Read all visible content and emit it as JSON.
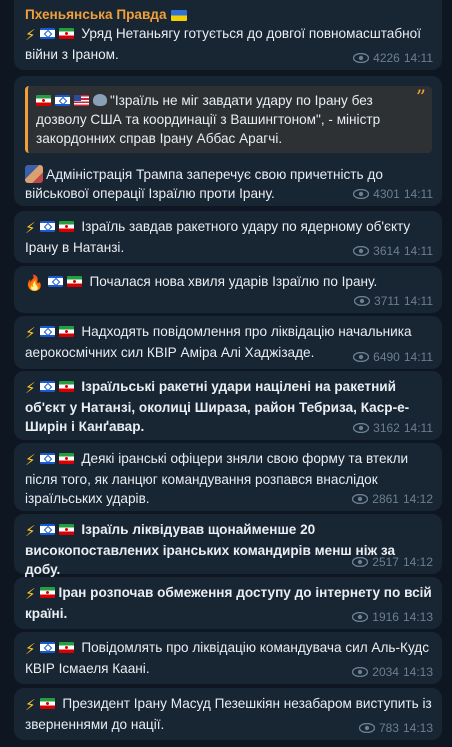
{
  "channel": {
    "name": "Пхеньянська Правда"
  },
  "posts": [
    {
      "text": "Уряд Нетаньягу готується до довгої повномасштабної війни з Іраном.",
      "views": "4226",
      "time": "14:11"
    },
    {
      "quote": "\"Ізраїль не міг завдати удару по Ірану без дозволу США та координації з Вашингтоном\", - міністр закордонних справ Ірану Аббас Арагчі.",
      "text": "Адміністрація Трампа заперечує свою причетність до військової операції Ізраїлю проти Ірану.",
      "views": "4301",
      "time": "14:11"
    },
    {
      "text": "Ізраїль завдав ракетного удару по ядерному об'єкту Ірану в Натанзі.",
      "views": "3614",
      "time": "14:11"
    },
    {
      "text": "Почалася нова хвиля ударів Ізраїлю по Ірану.",
      "views": "3711",
      "time": "14:11"
    },
    {
      "text": "Надходять повідомлення про ліквідацію начальника аерокосмічних сил КВІР Аміра Алі Хаджізаде.",
      "views": "6490",
      "time": "14:11"
    },
    {
      "text": "Ізраїльські ракетні удари націлені на ракетний об'єкт у Натанзі, околиці Шираза, район Тебриза, Каср-е-Ширін і Канґавар.",
      "views": "3162",
      "time": "14:11"
    },
    {
      "text": "Деякі іранські офіцери зняли свою форму та втекли після того, як ланцюг командування розпався внаслідок ізраїльських ударів.",
      "views": "2861",
      "time": "14:12"
    },
    {
      "text": "Ізраїль ліквідував щонайменше 20 високопоставлених іранських командирів менш ніж за добу.",
      "views": "2517",
      "time": "14:12"
    },
    {
      "text": "Іран розпочав обмеження доступу до інтернету по всій країні.",
      "views": "1916",
      "time": "14:13"
    },
    {
      "text": "Повідомлять про ліквідацію командувача сил Аль-Кудс КВІР Ісмаеля Каані.",
      "views": "2034",
      "time": "14:13"
    },
    {
      "text": "Президент Ірану Масуд Пезешкіян незабаром виступить із зверненнями до нації.",
      "views": "783",
      "time": "14:13"
    }
  ]
}
